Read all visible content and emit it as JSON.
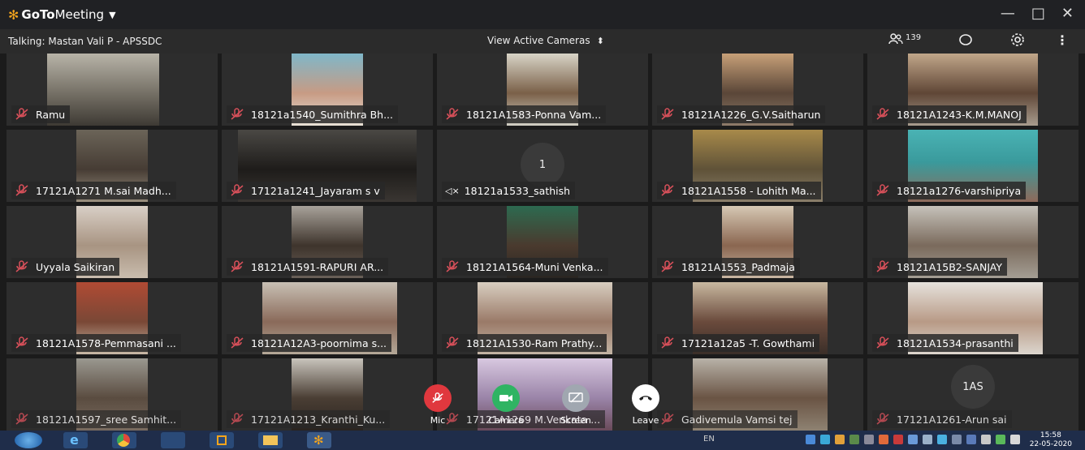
{
  "app": {
    "brand_goto": "GoTo",
    "brand_meeting": "Meeting",
    "window_controls": [
      "—",
      "□",
      "✕"
    ]
  },
  "toolbar": {
    "talking": "Talking: Mastan Vali P - APSSDC",
    "view_cameras": "View Active Cameras",
    "attendee_count": "139"
  },
  "participants": [
    {
      "name": "Ramu",
      "muted": true
    },
    {
      "name": "18121a1540_Sumithra Bh...",
      "muted": true
    },
    {
      "name": "18121A1583-Ponna Vam...",
      "muted": true
    },
    {
      "name": "18121A1226_G.V.Saitharun",
      "muted": true
    },
    {
      "name": "18121A1243-K.M.MANOJ",
      "muted": true
    },
    {
      "name": "17121A1271 M.sai Madh...",
      "muted": true
    },
    {
      "name": "17121a1241_Jayaram s v",
      "muted": true
    },
    {
      "name": "18121a1533_sathish",
      "muted": false,
      "speaker_off": true,
      "badge": "1"
    },
    {
      "name": "18121A1558 - Lohith Ma...",
      "muted": true
    },
    {
      "name": "18121a1276-varshipriya",
      "muted": true
    },
    {
      "name": "Uyyala Saikiran",
      "muted": true
    },
    {
      "name": "18121A1591-RAPURI AR...",
      "muted": true
    },
    {
      "name": "18121A1564-Muni Venka...",
      "muted": true
    },
    {
      "name": "18121A1553_Padmaja",
      "muted": true
    },
    {
      "name": "18121A15B2-SANJAY",
      "muted": true
    },
    {
      "name": "18121A1578-Pemmasani ...",
      "muted": true
    },
    {
      "name": "18121A12A3-poornima s...",
      "muted": true
    },
    {
      "name": "18121A1530-Ram Prathy...",
      "muted": true
    },
    {
      "name": "17121a12a5 -T. Gowthami",
      "muted": true
    },
    {
      "name": "18121A1534-prasanthi",
      "muted": true
    },
    {
      "name": "18121A1597_sree Samhit...",
      "muted": true
    },
    {
      "name": "17121A1213_Kranthi_Ku...",
      "muted": true
    },
    {
      "name": "17121A1269 M.Venkata ...",
      "muted": true
    },
    {
      "name": "Gadivemula Vamsi tej",
      "muted": true
    },
    {
      "name": "17121A1261-Arun sai",
      "muted": true,
      "badge": "1AS"
    }
  ],
  "controls": {
    "mic": "Mic",
    "camera": "Camera",
    "screen": "Screen",
    "leave": "Leave"
  },
  "colors": {
    "mic_red": "#e0383e",
    "camera_green": "#2fb463",
    "screen_gray": "#a0a7b0",
    "leave_white": "#ffffff",
    "muted_icon": "#d8505a",
    "brand_orange": "#f6a51c"
  },
  "taskbar": {
    "lang": "EN",
    "time": "15:58",
    "date": "22-05-2020"
  }
}
